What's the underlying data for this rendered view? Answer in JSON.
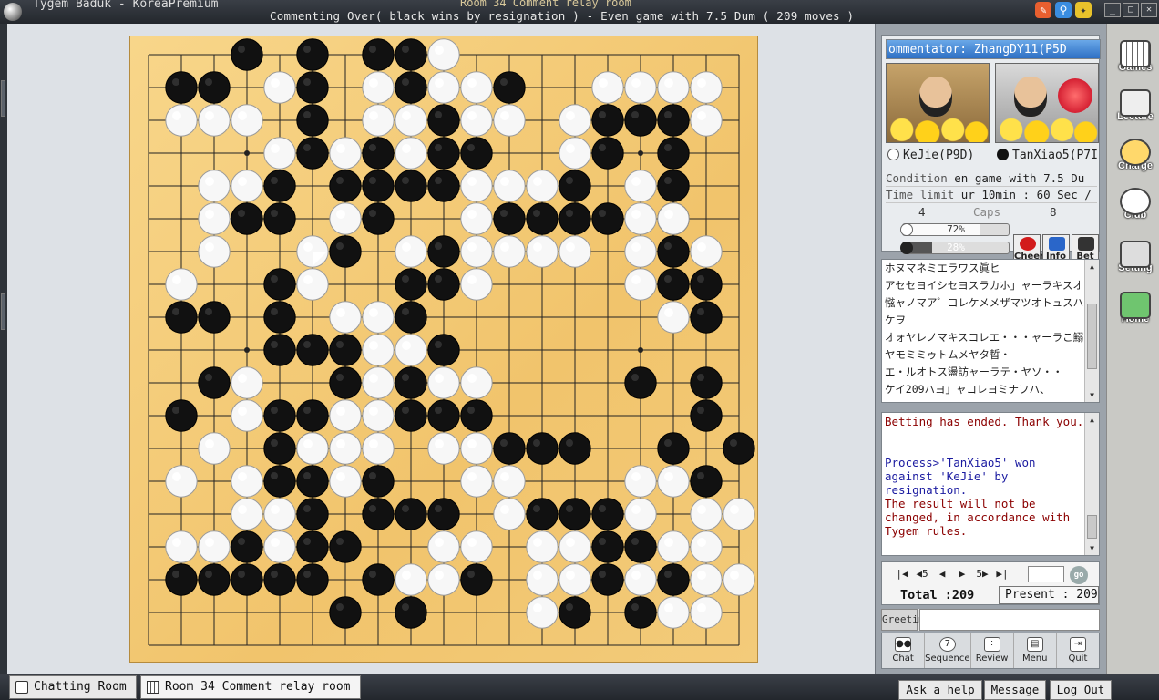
{
  "window": {
    "app_title": "Tygem Baduk - KoreaPremium",
    "room_title": "Room 34 Comment relay room",
    "game_info": "Commenting Over( black wins by resignation ) - Even game with 7.5 Dum  ( 209 moves )"
  },
  "board": {
    "size": 19,
    "colors": {
      "wood": "#f1c46c",
      "line": "#222222",
      "black": "#111111",
      "white": "#f7f7f7"
    },
    "stars": [
      [
        3,
        3
      ],
      [
        3,
        9
      ],
      [
        3,
        15
      ],
      [
        9,
        3
      ],
      [
        9,
        9
      ],
      [
        9,
        15
      ],
      [
        15,
        3
      ],
      [
        15,
        9
      ],
      [
        15,
        15
      ]
    ],
    "last_move": [
      5,
      6
    ],
    "black": [
      [
        3,
        0
      ],
      [
        5,
        0
      ],
      [
        7,
        0
      ],
      [
        8,
        0
      ],
      [
        1,
        1
      ],
      [
        2,
        1
      ],
      [
        5,
        1
      ],
      [
        8,
        1
      ],
      [
        11,
        1
      ],
      [
        5,
        2
      ],
      [
        9,
        2
      ],
      [
        14,
        2
      ],
      [
        15,
        2
      ],
      [
        16,
        2
      ],
      [
        5,
        3
      ],
      [
        7,
        3
      ],
      [
        9,
        3
      ],
      [
        10,
        3
      ],
      [
        14,
        3
      ],
      [
        16,
        3
      ],
      [
        4,
        4
      ],
      [
        6,
        4
      ],
      [
        7,
        4
      ],
      [
        8,
        4
      ],
      [
        9,
        4
      ],
      [
        13,
        4
      ],
      [
        16,
        4
      ],
      [
        3,
        5
      ],
      [
        4,
        5
      ],
      [
        7,
        5
      ],
      [
        11,
        5
      ],
      [
        12,
        5
      ],
      [
        13,
        5
      ],
      [
        14,
        5
      ],
      [
        16,
        5
      ],
      [
        6,
        6
      ],
      [
        9,
        6
      ],
      [
        16,
        6
      ],
      [
        4,
        7
      ],
      [
        8,
        7
      ],
      [
        9,
        7
      ],
      [
        16,
        7
      ],
      [
        17,
        7
      ],
      [
        1,
        8
      ],
      [
        2,
        8
      ],
      [
        4,
        8
      ],
      [
        8,
        8
      ],
      [
        17,
        8
      ],
      [
        4,
        9
      ],
      [
        5,
        9
      ],
      [
        6,
        9
      ],
      [
        9,
        9
      ],
      [
        2,
        10
      ],
      [
        6,
        10
      ],
      [
        8,
        10
      ],
      [
        15,
        10
      ],
      [
        17,
        10
      ],
      [
        1,
        11
      ],
      [
        4,
        11
      ],
      [
        5,
        11
      ],
      [
        8,
        11
      ],
      [
        9,
        11
      ],
      [
        10,
        11
      ],
      [
        17,
        11
      ],
      [
        4,
        12
      ],
      [
        5,
        12
      ],
      [
        11,
        12
      ],
      [
        12,
        12
      ],
      [
        13,
        12
      ],
      [
        16,
        12
      ],
      [
        18,
        12
      ],
      [
        4,
        13
      ],
      [
        5,
        13
      ],
      [
        7,
        13
      ],
      [
        17,
        13
      ],
      [
        5,
        14
      ],
      [
        7,
        14
      ],
      [
        8,
        14
      ],
      [
        9,
        14
      ],
      [
        12,
        14
      ],
      [
        13,
        14
      ],
      [
        14,
        14
      ],
      [
        3,
        15
      ],
      [
        5,
        15
      ],
      [
        6,
        15
      ],
      [
        14,
        15
      ],
      [
        15,
        15
      ],
      [
        1,
        16
      ],
      [
        2,
        16
      ],
      [
        3,
        16
      ],
      [
        4,
        16
      ],
      [
        5,
        16
      ],
      [
        7,
        16
      ],
      [
        10,
        16
      ],
      [
        14,
        16
      ],
      [
        16,
        16
      ],
      [
        6,
        17
      ],
      [
        8,
        17
      ],
      [
        13,
        17
      ],
      [
        15,
        17
      ]
    ],
    "white": [
      [
        9,
        0
      ],
      [
        4,
        1
      ],
      [
        7,
        1
      ],
      [
        9,
        1
      ],
      [
        10,
        1
      ],
      [
        14,
        1
      ],
      [
        15,
        1
      ],
      [
        16,
        1
      ],
      [
        17,
        1
      ],
      [
        1,
        2
      ],
      [
        2,
        2
      ],
      [
        3,
        2
      ],
      [
        7,
        2
      ],
      [
        8,
        2
      ],
      [
        10,
        2
      ],
      [
        11,
        2
      ],
      [
        13,
        2
      ],
      [
        17,
        2
      ],
      [
        4,
        3
      ],
      [
        6,
        3
      ],
      [
        8,
        3
      ],
      [
        13,
        3
      ],
      [
        2,
        4
      ],
      [
        3,
        4
      ],
      [
        10,
        4
      ],
      [
        11,
        4
      ],
      [
        12,
        4
      ],
      [
        15,
        4
      ],
      [
        2,
        5
      ],
      [
        6,
        5
      ],
      [
        10,
        5
      ],
      [
        15,
        5
      ],
      [
        16,
        5
      ],
      [
        2,
        6
      ],
      [
        5,
        6
      ],
      [
        8,
        6
      ],
      [
        10,
        6
      ],
      [
        11,
        6
      ],
      [
        12,
        6
      ],
      [
        13,
        6
      ],
      [
        15,
        6
      ],
      [
        17,
        6
      ],
      [
        1,
        7
      ],
      [
        5,
        7
      ],
      [
        10,
        7
      ],
      [
        15,
        7
      ],
      [
        6,
        8
      ],
      [
        7,
        8
      ],
      [
        16,
        8
      ],
      [
        7,
        9
      ],
      [
        8,
        9
      ],
      [
        3,
        10
      ],
      [
        7,
        10
      ],
      [
        9,
        10
      ],
      [
        10,
        10
      ],
      [
        3,
        11
      ],
      [
        6,
        11
      ],
      [
        7,
        11
      ],
      [
        2,
        12
      ],
      [
        5,
        12
      ],
      [
        6,
        12
      ],
      [
        7,
        12
      ],
      [
        9,
        12
      ],
      [
        10,
        12
      ],
      [
        1,
        13
      ],
      [
        3,
        13
      ],
      [
        6,
        13
      ],
      [
        10,
        13
      ],
      [
        11,
        13
      ],
      [
        15,
        13
      ],
      [
        16,
        13
      ],
      [
        3,
        14
      ],
      [
        4,
        14
      ],
      [
        11,
        14
      ],
      [
        15,
        14
      ],
      [
        17,
        14
      ],
      [
        18,
        14
      ],
      [
        1,
        15
      ],
      [
        2,
        15
      ],
      [
        4,
        15
      ],
      [
        9,
        15
      ],
      [
        10,
        15
      ],
      [
        12,
        15
      ],
      [
        13,
        15
      ],
      [
        16,
        15
      ],
      [
        17,
        15
      ],
      [
        8,
        16
      ],
      [
        9,
        16
      ],
      [
        12,
        16
      ],
      [
        13,
        16
      ],
      [
        15,
        16
      ],
      [
        17,
        16
      ],
      [
        18,
        16
      ],
      [
        12,
        17
      ],
      [
        16,
        17
      ],
      [
        17,
        17
      ]
    ]
  },
  "commentary": {
    "header": "ommentator: ZhangDY11(P5D",
    "player_white": "KeJie(P9D)",
    "player_black": "TanXiao5(P7I",
    "condition_label": "Condition",
    "condition_value": "en game with 7.5 Du",
    "time_label": "Time limit",
    "time_value": "ur 10min : 60 Sec /",
    "caps_white": "4",
    "caps_label": "Caps",
    "caps_black": "8",
    "win_rate_white": "72%",
    "win_rate_white_value": 72,
    "win_rate_black": "28%",
    "win_rate_black_value": 28,
    "btn_cheer": "Cheer",
    "btn_info": "Info",
    "btn_bet": "Bet"
  },
  "chatlog": [
    "ホヌマネミエラワス眞ヒ",
    "アセセヨイシセヨスラカホ」ャーラキスオ・モイサエ",
    "惤ャノマア゜コレケメメザマツオトュスハ・「イサウノ",
    "ケヲ",
    "オォヤレノマキスコレエ・・・ャーラこ鰯トモヲカ",
    "ヤモミミゥトムメヤタ晢・",
    "エ・ルオトス盪訪ャーラテ・ヤソ・・",
    "ケイ209ハヨ」ャコレヨミナフハ、"
  ],
  "messages": {
    "bet_end": "Betting has ended. Thank you.",
    "process": "Process>'TanXiao5' won against 'KeJie' by resignation.",
    "result": "The result will not be changed, in accordance with Tygem rules."
  },
  "navigation": {
    "first": "|◀",
    "back5": "◀5",
    "back": "◀",
    "forward": "▶",
    "forward5": "5▶",
    "last": "▶|",
    "go": "go",
    "total": "Total :209",
    "present": "Present : 209"
  },
  "greeting_label": "Greeting",
  "bottom_buttons": [
    "Chat",
    "Sequence",
    "Review",
    "Menu",
    "Quit"
  ],
  "sidebar": [
    "Games",
    "Lecture",
    "Charge",
    "Club",
    "Setting",
    "Home"
  ],
  "status": {
    "tab_chat": "Chatting Room",
    "tab_room": "Room 34 Comment relay room",
    "help": "Ask a help",
    "message": "Message",
    "logout": "Log Out"
  }
}
